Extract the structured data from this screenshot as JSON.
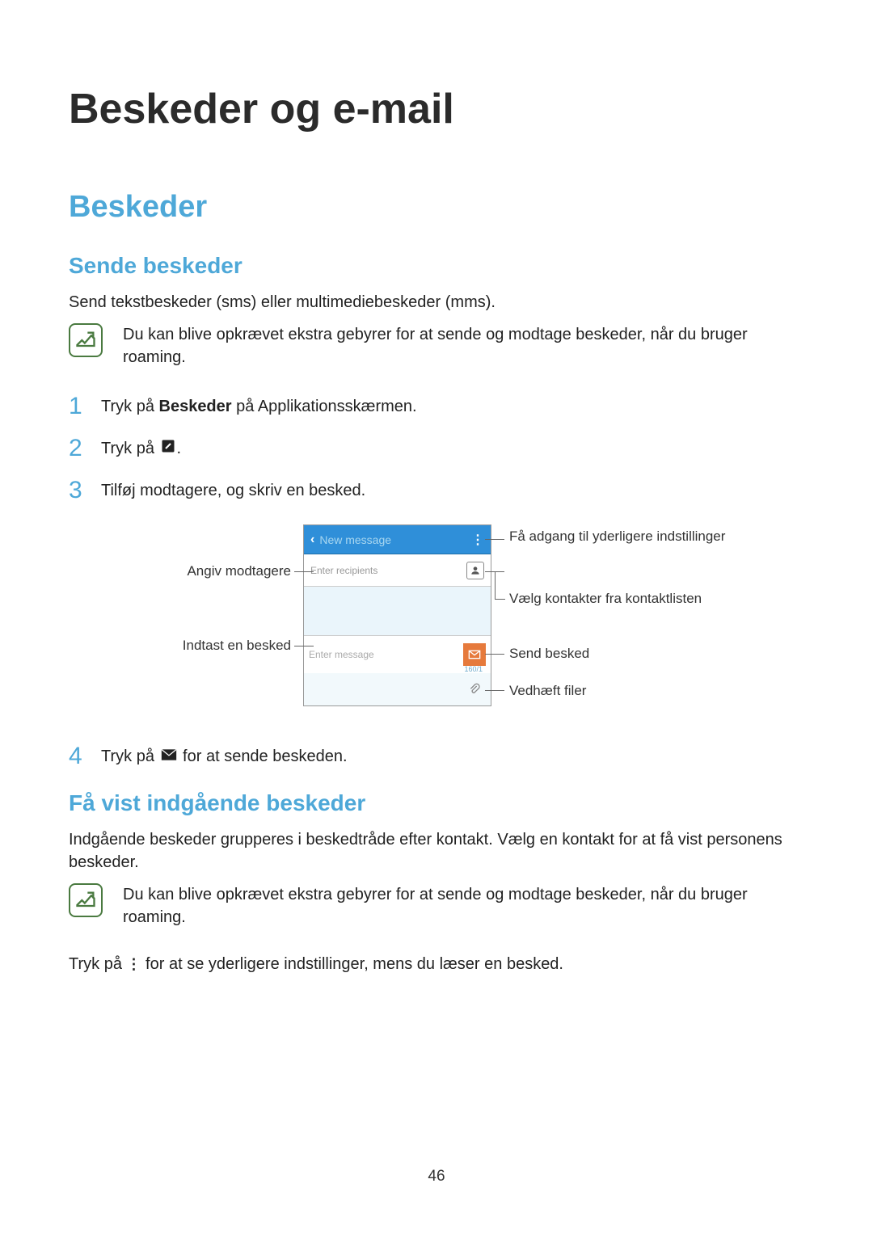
{
  "page": {
    "title": "Beskeder og e-mail",
    "section": "Beskeder",
    "sub1": "Sende beskeder",
    "intro": "Send tekstbeskeder (sms) eller multimediebeskeder (mms).",
    "note1": "Du kan blive opkrævet ekstra gebyrer for at sende og modtage beskeder, når du bruger roaming.",
    "step1_a": "Tryk på ",
    "step1_b": "Beskeder",
    "step1_c": " på Applikationsskærmen.",
    "step2": "Tryk på ",
    "step2_end": ".",
    "step3": "Tilføj modtagere, og skriv en besked.",
    "step4_a": "Tryk på ",
    "step4_b": " for at sende beskeden.",
    "num1": "1",
    "num2": "2",
    "num3": "3",
    "num4": "4",
    "callouts": {
      "left1": "Angiv modtagere",
      "left2": "Indtast en besked",
      "right1": "Få adgang til yderligere indstillinger",
      "right2": "Vælg kontakter fra kontaktlisten",
      "right3": "Send besked",
      "right4": "Vedhæft filer"
    },
    "ui": {
      "header": "New message",
      "recipients": "Enter recipients",
      "message": "Enter message",
      "counter": "160/1"
    },
    "sub2": "Få vist indgående beskeder",
    "sub2_body": "Indgående beskeder grupperes i beskedtråde efter kontakt. Vælg en kontakt for at få vist personens beskeder.",
    "note2": "Du kan blive opkrævet ekstra gebyrer for at sende og modtage beskeder, når du bruger roaming.",
    "post_note_a": "Tryk på ",
    "post_note_b": " for at se yderligere indstillinger, mens du læser en besked.",
    "page_num": "46"
  }
}
